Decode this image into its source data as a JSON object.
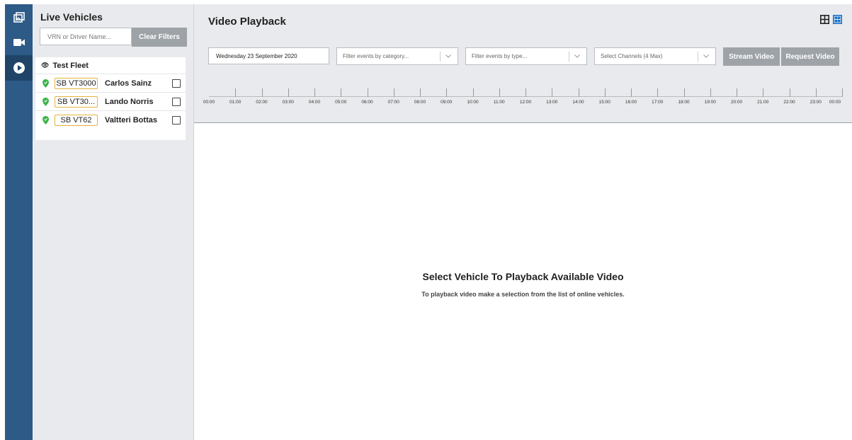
{
  "rail": {
    "items": [
      "live-gallery-icon",
      "video-camera-icon",
      "play-circle-icon"
    ]
  },
  "sidebar": {
    "title": "Live Vehicles",
    "search_placeholder": "VRN or Driver Name...",
    "clear_label": "Clear Filters",
    "fleet": {
      "name": "Test Fleet",
      "vehicles": [
        {
          "plate": "SB VT3000",
          "driver": "Carlos Sainz",
          "status_color": "#3cb44b"
        },
        {
          "plate": "SB VT30...",
          "driver": "Lando Norris",
          "status_color": "#3cb44b"
        },
        {
          "plate": "SB VT62",
          "driver": "Valtteri Bottas",
          "status_color": "#3cb44b"
        }
      ]
    }
  },
  "main": {
    "title": "Video Playback",
    "date": "Wednesday 23 September 2020",
    "filters": {
      "category_placeholder": "Filter events by category...",
      "type_placeholder": "Filter events by type...",
      "channels_placeholder": "Select Channels (4 Max)"
    },
    "stream_label": "Stream Video",
    "request_label": "Request Video",
    "timeline_labels": [
      "00:00",
      "01:00",
      "02:00",
      "03:00",
      "04:00",
      "05:00",
      "06:00",
      "07:00",
      "08:00",
      "09:00",
      "10:00",
      "11:00",
      "12:00",
      "13:00",
      "14:00",
      "15:00",
      "16:00",
      "17:00",
      "18:00",
      "19:00",
      "20:00",
      "21:00",
      "22:00",
      "23:00",
      "00:00"
    ],
    "empty_title": "Select Vehicle To Playback Available Video",
    "empty_subtitle": "To playback video make a selection from the list of online vehicles."
  },
  "colors": {
    "rail": "#2d5a87",
    "button": "#9ea3a8",
    "plate_border": "#e3b23c",
    "online": "#3cb44b",
    "grid_icon_active": "#1a73c9"
  }
}
